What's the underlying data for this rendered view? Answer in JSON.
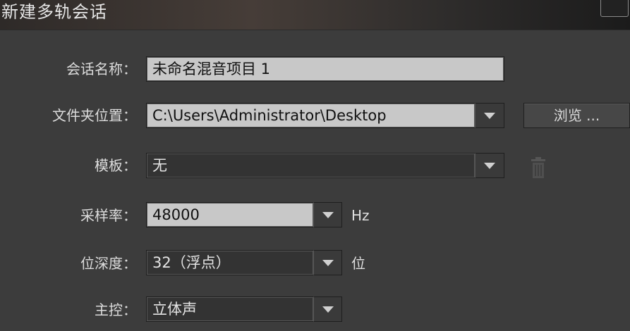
{
  "dialog": {
    "title": "新建多轨会话"
  },
  "form": {
    "session_name": {
      "label": "会话名称：",
      "value": "未命名混音项目 1"
    },
    "folder_location": {
      "label": "文件夹位置：",
      "value": "C:\\Users\\Administrator\\Desktop",
      "browse_label": "浏览 ..."
    },
    "template": {
      "label": "模板：",
      "value": "无",
      "delete_icon": "trash-icon"
    },
    "sample_rate": {
      "label": "采样率：",
      "value": "48000",
      "unit": "Hz"
    },
    "bit_depth": {
      "label": "位深度：",
      "value": "32（浮点）",
      "unit": "位"
    },
    "master": {
      "label": "主控：",
      "value": "立体声"
    }
  },
  "icons": {
    "dropdown": "chevron-down-icon",
    "close": "close-icon"
  },
  "colors": {
    "dialog_background": "#3c3c3c",
    "input_light": "#c8c8c8",
    "input_dark": "#333333",
    "text": "#dcdcdc"
  }
}
